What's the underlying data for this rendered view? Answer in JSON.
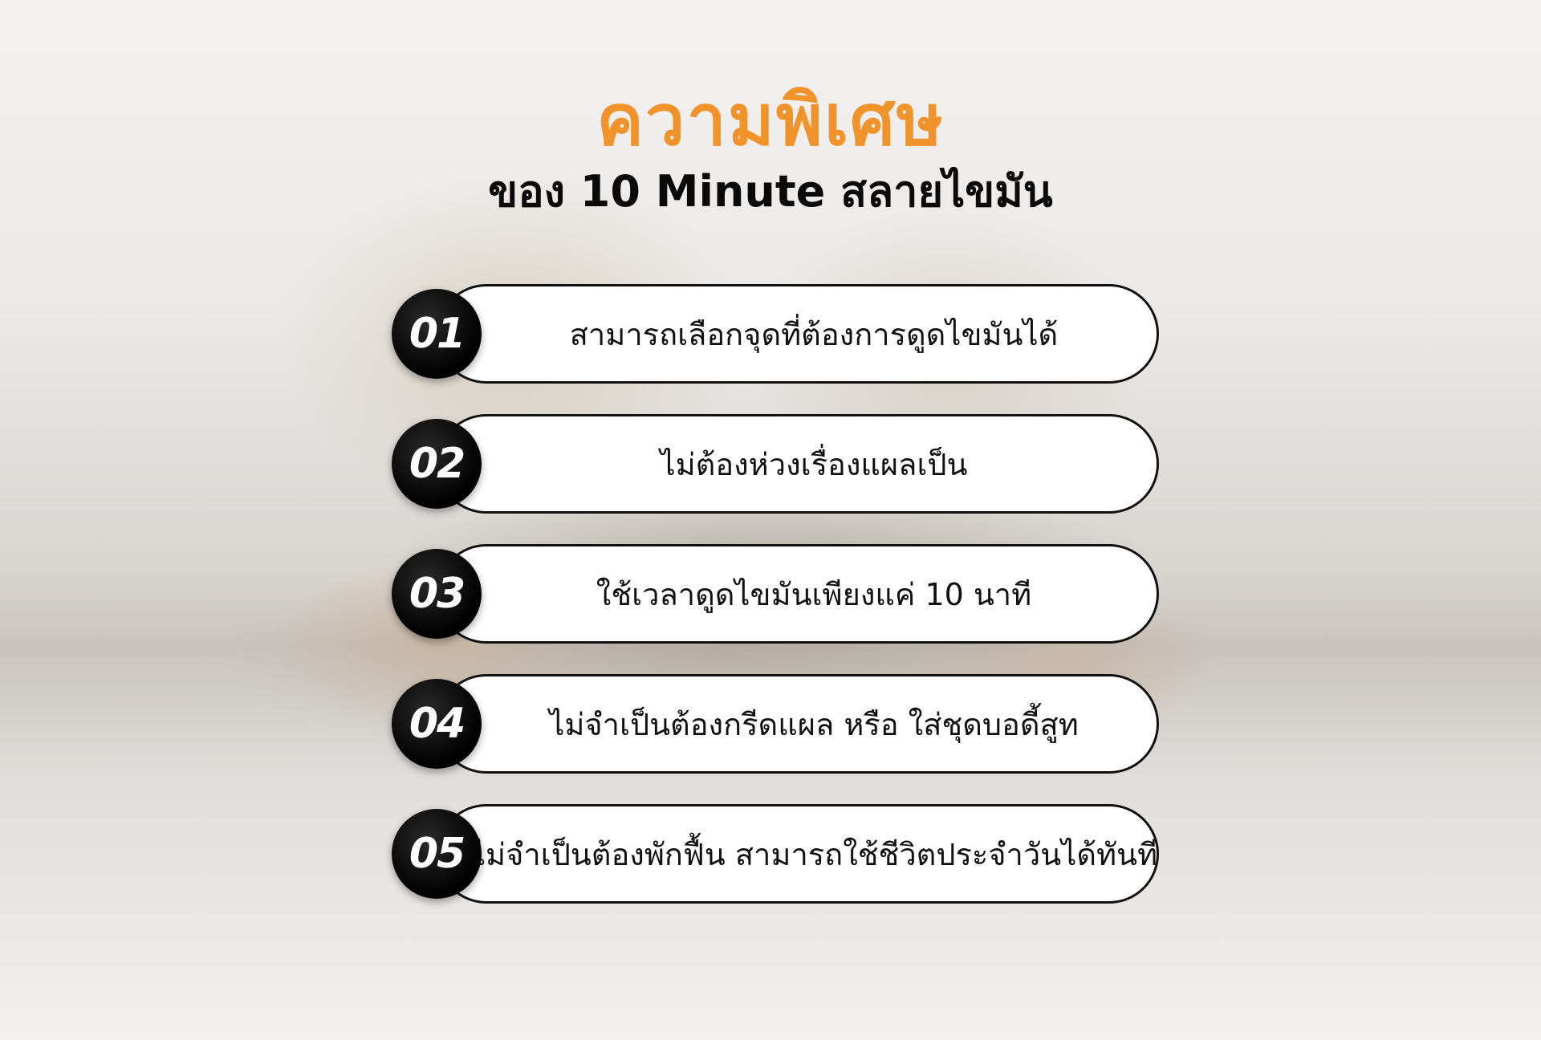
{
  "title": {
    "main": "ความพิเศษ",
    "sub": "ของ 10 Minute สลายไขมัน"
  },
  "features": [
    {
      "number": "01",
      "text": "สามารถเลือกจุดที่ต้องการดูดไขมันได้"
    },
    {
      "number": "02",
      "text": "ไม่ต้องห่วงเรื่องแผลเป็น"
    },
    {
      "number": "03",
      "text": "ใช้เวลาดูดไขมันเพียงแค่ 10 นาที"
    },
    {
      "number": "04",
      "text": "ไม่จำเป็นต้องกรีดแผล หรือ ใส่ชุดบอดี้สูท"
    },
    {
      "number": "05",
      "text": "ไม่จำเป็นต้องพักฟื้น สามารถใช้ชีวิตประจำวันได้ทันที"
    }
  ],
  "colors": {
    "title_accent": "#f0932b",
    "subtitle": "#0a0a0a",
    "badge": "#000000",
    "pill_border": "#111111",
    "pill_fill": "#ffffff"
  }
}
